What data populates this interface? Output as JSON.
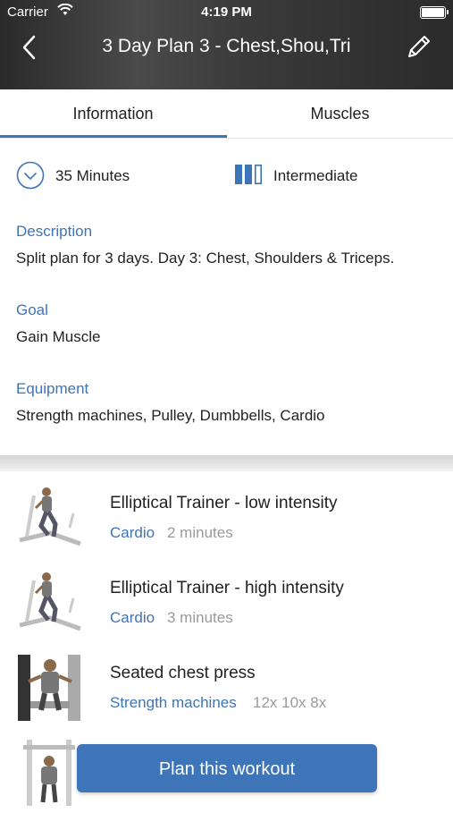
{
  "status_bar": {
    "carrier": "Carrier",
    "time": "4:19 PM"
  },
  "header": {
    "title": "3 Day Plan 3 - Chest,Shou,Tri"
  },
  "tabs": [
    {
      "label": "Information"
    },
    {
      "label": "Muscles"
    }
  ],
  "meta": {
    "duration": "35 Minutes",
    "level": "Intermediate"
  },
  "sections": [
    {
      "title": "Description",
      "text": "Split plan for 3 days. Day 3: Chest, Shoulders & Triceps."
    },
    {
      "title": "Goal",
      "text": "Gain Muscle"
    },
    {
      "title": "Equipment",
      "text": "Strength machines, Pulley, Dumbbells, Cardio"
    }
  ],
  "exercises": [
    {
      "name": "Elliptical Trainer - low intensity",
      "category": "Cardio",
      "detail": "2 minutes"
    },
    {
      "name": "Elliptical Trainer - high intensity",
      "category": "Cardio",
      "detail": "3 minutes"
    },
    {
      "name": "Seated chest press",
      "category": "Strength machines",
      "detail": "12x 10x 8x"
    }
  ],
  "cta": {
    "label": "Plan this workout"
  },
  "colors": {
    "accent": "#3e74b8",
    "muted": "#9a9a9a",
    "header_bg": "#333333"
  }
}
